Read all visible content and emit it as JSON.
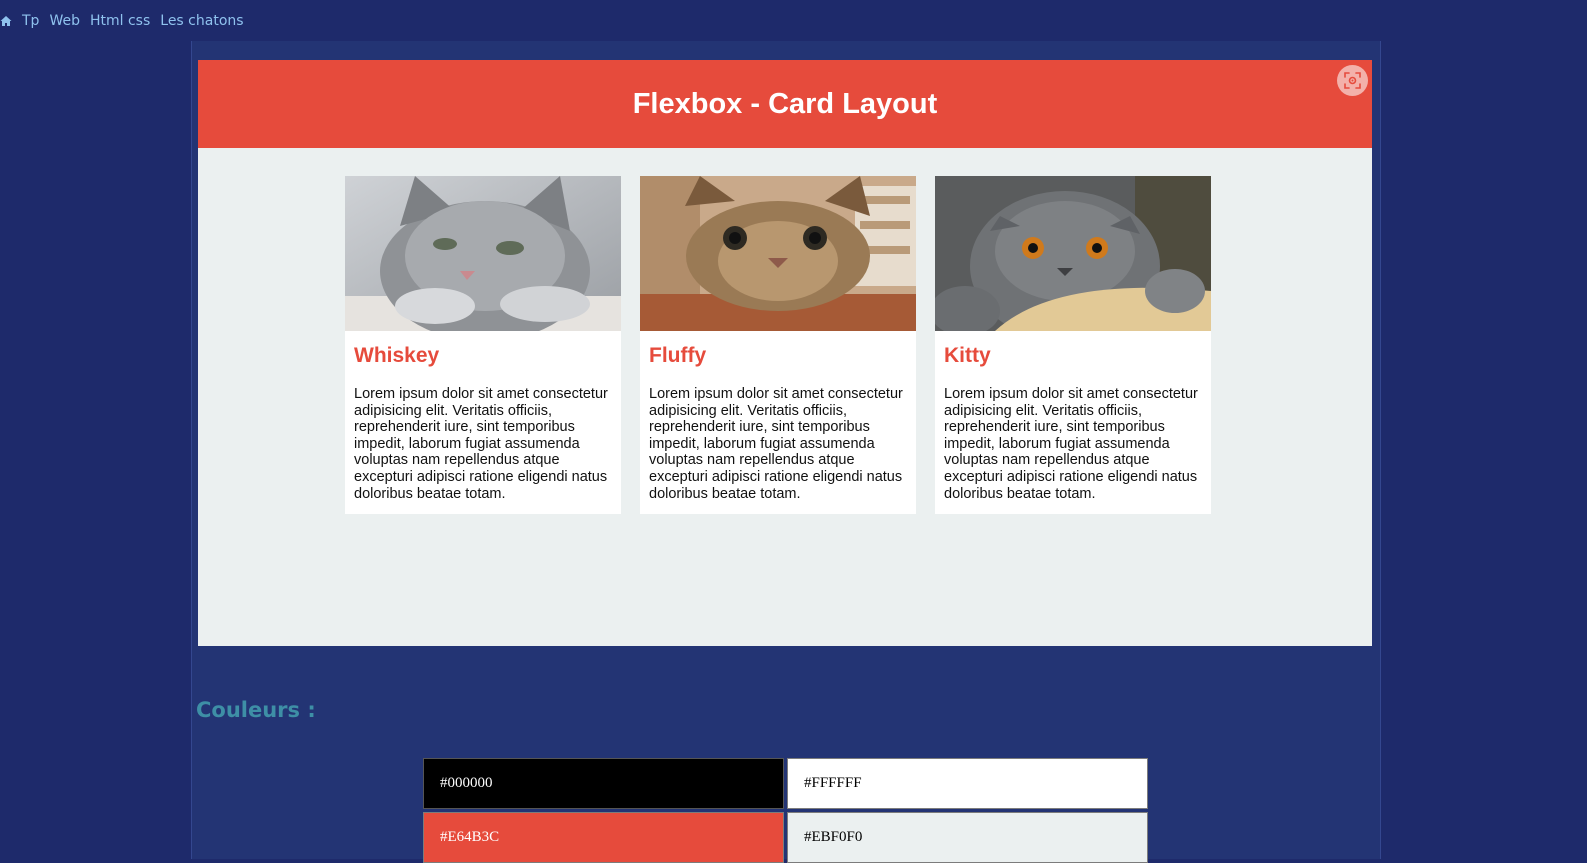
{
  "breadcrumb": {
    "items": [
      "Tp",
      "Web",
      "Html css",
      "Les chatons"
    ],
    "color": "#8fc2ee"
  },
  "demo": {
    "title": "Flexbox - Card Layout",
    "header_color": "#e64b3c",
    "background_color": "#ebf0f0",
    "fullscreen_icon": "fullscreen-icon",
    "cards": [
      {
        "name": "Whiskey",
        "image": "grey-kitten-photo",
        "text": "Lorem ipsum dolor sit amet consectetur adipisicing elit. Veritatis officiis, reprehenderit iure, sint temporibus impedit, laborum fugiat assumenda voluptas nam repellendus atque excepturi adipisci ratione eligendi natus doloribus beatae totam."
      },
      {
        "name": "Fluffy",
        "image": "tabby-cat-photo",
        "text": "Lorem ipsum dolor sit amet consectetur adipisicing elit. Veritatis officiis, reprehenderit iure, sint temporibus impedit, laborum fugiat assumenda voluptas nam repellendus atque excepturi adipisci ratione eligendi natus doloribus beatae totam."
      },
      {
        "name": "Kitty",
        "image": "grey-fold-cat-photo",
        "text": "Lorem ipsum dolor sit amet consectetur adipisicing elit. Veritatis officiis, reprehenderit iure, sint temporibus impedit, laborum fugiat assumenda voluptas nam repellendus atque excepturi adipisci ratione eligendi natus doloribus beatae totam."
      }
    ]
  },
  "colors": {
    "heading": "Couleurs :",
    "swatches": [
      {
        "label": "#000000",
        "bg": "#000000",
        "fg": "#ffffff"
      },
      {
        "label": "#FFFFFF",
        "bg": "#FFFFFF",
        "fg": "#000000"
      },
      {
        "label": "#E64B3C",
        "bg": "#E64B3C",
        "fg": "#ffffff"
      },
      {
        "label": "#EBF0F0",
        "bg": "#EBF0F0",
        "fg": "#000000"
      }
    ]
  }
}
